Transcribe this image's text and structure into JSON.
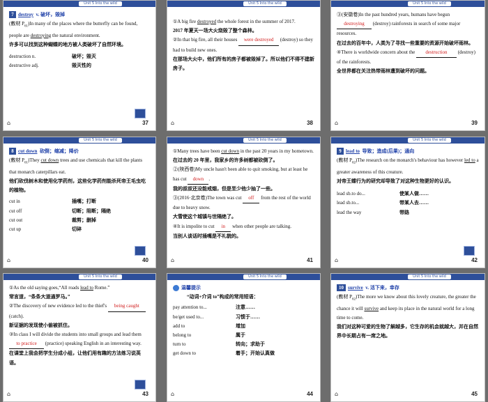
{
  "header_label": "Unit 5  Into the wild",
  "slides": [
    {
      "page": "37",
      "lines": {
        "l1_word": "destroy",
        "l1_pos": "v.",
        "l1_zh": "破坏，毁掉",
        "l2": "(教材 P",
        "l2_sub": "61",
        "l2b": ")In many of the places where the butterfly can be found, people are ",
        "l2_u": "destroying",
        "l2c": " the natural environment.",
        "l3": "许多可以找到这种蝴蝶的地方被人类破坏了自然环境。",
        "r1k": "destruction n.",
        "r1v": "破坏；毁灭",
        "r2k": "destructive adj.",
        "r2v": "毁灭性的"
      }
    },
    {
      "page": "38",
      "lines": {
        "a1": "①A big fire ",
        "a1_u": "destroyed",
        "a1b": " the whole forest in the summer of 2017.",
        "a2": "2017 年夏天一场大火烧毁了整个森林。",
        "b1": "②In that big fire, all their houses ",
        "b1_blank": "were destroyed",
        "b1b": " (destroy) so they had to build new ones.",
        "b2": "在那场大火中，他们所有的房子都被毁掉了。所以他们不得不建新房子。"
      }
    },
    {
      "page": "39",
      "lines": {
        "c1": "③(安徽卷)In the past hundred years, humans have begun ",
        "c1_blank": "destroying",
        "c1b": " (destroy) rainforests in search of some major resources.",
        "c2": "在过去的百年中，人类为了寻找一些重要的资源开始破坏雨林。",
        "d1": "④There is worldwide concern about the ",
        "d1_blank": "destruction",
        "d1b": " (destroy) of the rainforests.",
        "d2": "全世界都在关注热带雨林遭到破坏的问题。"
      }
    },
    {
      "page": "40",
      "lines": {
        "h_word": "cut down",
        "h_zh": "砍倒；缩减；降价",
        "p1": "(教材 P",
        "p1_sub": "61",
        "p1b": ")They ",
        "p1_u": "cut down",
        "p1c": " trees and use chemicals that kill the plants that monarch caterpillars eat.",
        "p2": "他们砍伐树木和使用化学药剂，这些化学药剂能杀死帝王毛虫吃的植物。",
        "items": [
          [
            "cut in",
            "插嘴；打断"
          ],
          [
            "cut off",
            "切断；阻断；隔绝"
          ],
          [
            "cut out",
            "裁剪；删掉"
          ],
          [
            "cut up",
            "切碎"
          ]
        ]
      }
    },
    {
      "page": "41",
      "lines": {
        "q1": "①Many trees have been ",
        "q1_u": "cut down",
        "q1b": " in the past 20 years in my hometown.",
        "q1z": "在过去的 20 年里，我家乡的许多树都被砍倒了。",
        "q2": "②(陕西卷)My uncle hasn't been able to quit smoking, but at least he has cut ",
        "q2_blank": "down",
        "q2b": ".",
        "q2z": "我的叔叔还没能戒烟，但是至少他少抽了一些。",
        "q3": "③(2016·北京卷)The town was cut ",
        "q3_blank": "off",
        "q3b": " from the rest of the world due to heavy snow.",
        "q3z": "大雪使这个城镇与世隔绝了。",
        "q4": "④It is impolite to cut ",
        "q4_blank": "in",
        "q4b": " when other people are talking.",
        "q4z": "当别人谈话时插嘴是不礼貌的。"
      }
    },
    {
      "page": "42",
      "lines": {
        "h_word": "lead to",
        "h_zh": "导致；造成(后果)；通向",
        "p1": "(教材 P",
        "p1_sub": "62",
        "p1b": ")The research on the monarch's behaviour has however ",
        "p1_u": "led to",
        "p1c": " a greater awareness of this creature.",
        "p2": "对帝王蝶行为的研究却导致了对这种生物更好的认识。",
        "items": [
          [
            "lead sb.to do...",
            "使某人做……"
          ],
          [
            "lead sb.to...",
            "带某人去……"
          ],
          [
            "lead the way",
            "带路"
          ]
        ]
      }
    },
    {
      "page": "43",
      "lines": {
        "s1": "①As the old saying goes,“All roads ",
        "s1_u": "lead to",
        "s1b": " Rome.”",
        "s1z": "常言道，“条条大道通罗马。”",
        "s2": "②The discovery of new evidence led to the thief's ",
        "s2_blank": "being caught",
        "s2b": " (catch).",
        "s2z": "新证据的发现使小偷被抓住。",
        "s3": "③In class I will divide the students into small groups and lead them ",
        "s3_blank": "to practice",
        "s3b": " (practice) speaking English in an interesting way.",
        "s3z": "在课堂上我会把学生分成小组，让他们用有趣的方法练习说英语。"
      }
    },
    {
      "page": "44",
      "lines": {
        "tip": "温馨提示",
        "title": "“动词+介词 to”构成的常用短语：",
        "items": [
          [
            "pay attention to...",
            "注意……"
          ],
          [
            "be/get used to...",
            "习惯于……"
          ],
          [
            "add to",
            "增加"
          ],
          [
            "belong to",
            "属于"
          ],
          [
            "turn to",
            "转向；求助于"
          ],
          [
            "get down to",
            "着手；开始认真做"
          ]
        ]
      }
    },
    {
      "page": "45",
      "lines": {
        "h_word": "survive",
        "h_zh": "v. 活下来，幸存",
        "p1": "(教材 P",
        "p1_sub": "62",
        "p1b": ")The more we know about this lovely creature, the greater the chance it will ",
        "p1_u": "survive",
        "p1c": " and keep its place in the natural world for a long time to come.",
        "p2": "我们对这种可爱的生物了解越多，它生存的机会就越大，并在自然界中长期占有一席之地。"
      }
    }
  ],
  "badges": {
    "s37": "7",
    "s40": "8",
    "s42": "9",
    "s45": "10"
  },
  "colors": {
    "header": "#2e4f9a",
    "blank": "#d01818",
    "keyword": "#1d3fa8"
  }
}
